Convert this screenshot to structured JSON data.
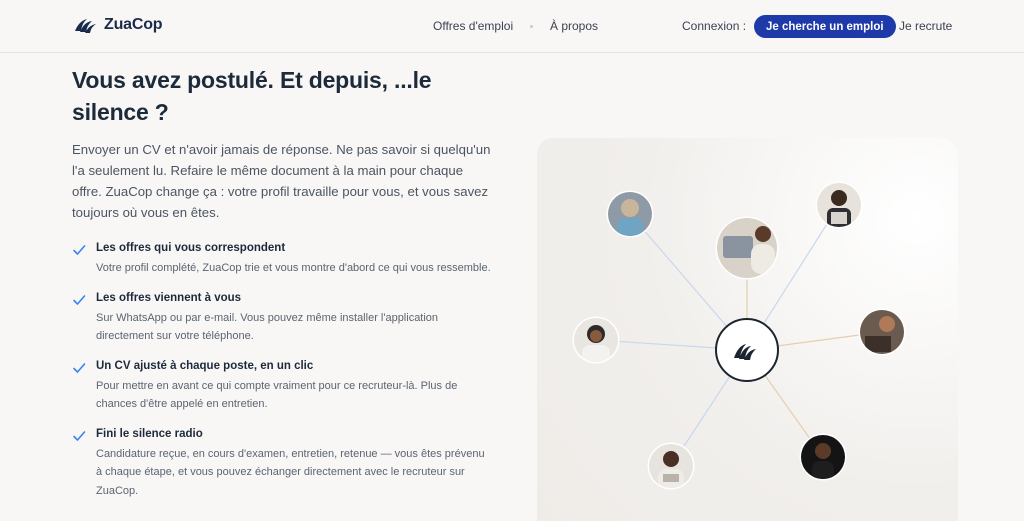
{
  "brand": {
    "name": "ZuaCop",
    "logo_icon": "wing-logo-icon"
  },
  "nav": {
    "offres": "Offres d'emploi",
    "apropos": "À propos",
    "connexion": "Connexion :",
    "cta": "Je cherche un emploi",
    "recrute": "Je recrute"
  },
  "hero": {
    "title": "Vous avez postulé. Et depuis, ...le silence ?",
    "intro": "Envoyer un CV et n'avoir jamais de réponse. Ne pas savoir si quelqu'un l'a seulement lu. Refaire le même document à la main pour chaque offre. ZuaCop change ça : votre profil travaille pour vous, et vous savez toujours où vous en êtes."
  },
  "features": [
    {
      "title": "Les offres qui vous correspondent",
      "desc": "Votre profil complété, ZuaCop trie et vous montre d'abord ce qui vous ressemble."
    },
    {
      "title": "Les offres viennent à vous",
      "desc": "Sur WhatsApp ou par e-mail. Vous pouvez même installer l'application directement sur votre téléphone."
    },
    {
      "title": "Un CV ajusté à chaque poste, en un clic",
      "desc": "Pour mettre en avant ce qui compte vraiment pour ce recruteur-là. Plus de chances d'être appelé en entretien."
    },
    {
      "title": "Fini le silence radio",
      "desc": "Candidature reçue, en cours d'examen, entretien, retenue — vous êtes prévenu à chaque étape, et vous pouvez échanger directement avec le recruteur sur ZuaCop."
    }
  ],
  "colors": {
    "primary": "#1e3aa8",
    "navy": "#1a2b4c",
    "check": "#3b82f6"
  }
}
